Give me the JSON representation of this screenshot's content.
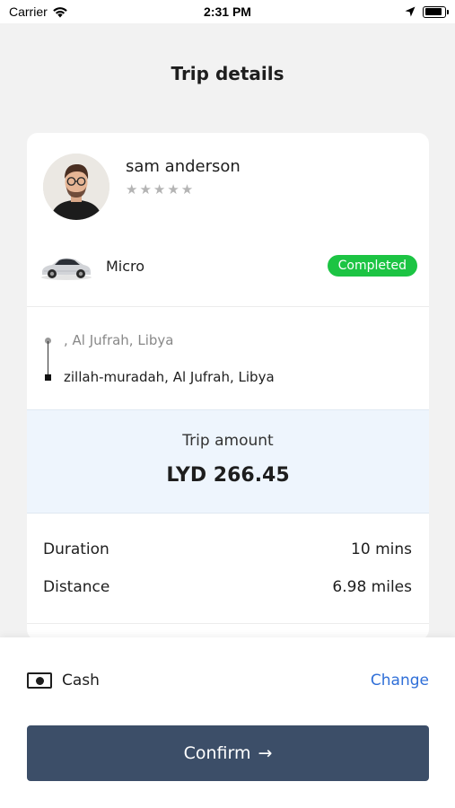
{
  "status_bar": {
    "carrier": "Carrier",
    "time": "2:31 PM",
    "battery_level": 0.9
  },
  "page": {
    "title": "Trip details"
  },
  "driver": {
    "name": "sam anderson",
    "stars": "★★★★★",
    "rating": 0
  },
  "vehicle": {
    "type": "Micro",
    "status": "Completed"
  },
  "route": {
    "pickup": ", Al Jufrah, Libya",
    "dropoff": "zillah-muradah, Al Jufrah, Libya"
  },
  "trip_amount": {
    "label": "Trip amount",
    "value": "LYD 266.45"
  },
  "stats": {
    "duration_label": "Duration",
    "duration_value": "10 mins",
    "distance_label": "Distance",
    "distance_value": "6.98 miles"
  },
  "payment": {
    "method": "Cash",
    "change_label": "Change"
  },
  "confirm": {
    "label": "Confirm",
    "arrow": "→"
  },
  "colors": {
    "status_badge": "#1cc443",
    "confirm_button": "#3c4e68",
    "link": "#2f6fd8",
    "amount_bg": "#eef5fd"
  }
}
